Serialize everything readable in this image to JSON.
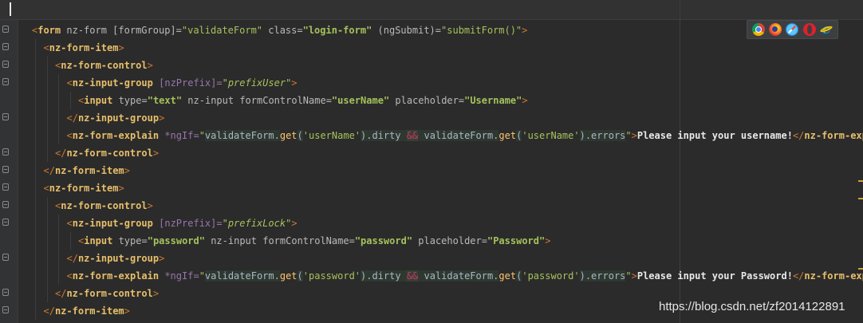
{
  "editor": {
    "lines": [
      [
        [
          "op",
          "<"
        ],
        [
          "tag",
          "form"
        ],
        [
          "attr",
          " nz-form "
        ],
        [
          "attr",
          "[formGroup]="
        ],
        [
          "str",
          "\"validateForm\""
        ],
        [
          "attr",
          " class="
        ],
        [
          "strb",
          "\"login-form\""
        ],
        [
          "attr",
          " (ngSubmit)="
        ],
        [
          "str",
          "\"submitForm()\""
        ],
        [
          "op",
          ">"
        ]
      ],
      [
        [
          "op",
          "<"
        ],
        [
          "tag",
          "nz-form-item"
        ],
        [
          "op",
          ">"
        ]
      ],
      [
        [
          "op",
          "<"
        ],
        [
          "tag",
          "nz-form-control"
        ],
        [
          "op",
          ">"
        ]
      ],
      [
        [
          "op",
          "<"
        ],
        [
          "tag",
          "nz-input-group"
        ],
        [
          "ngattr",
          " [nzPrefix]="
        ],
        [
          "stri",
          "\"prefixUser\""
        ],
        [
          "op",
          ">"
        ]
      ],
      [
        [
          "op",
          "<"
        ],
        [
          "tag",
          "input"
        ],
        [
          "attr",
          " type="
        ],
        [
          "strb",
          "\"text\""
        ],
        [
          "attr",
          " nz-input formControlName="
        ],
        [
          "strb",
          "\"userName\""
        ],
        [
          "attr",
          " placeholder="
        ],
        [
          "strb",
          "\"Username\""
        ],
        [
          "op",
          ">"
        ]
      ],
      [
        [
          "op",
          "</"
        ],
        [
          "tag",
          "nz-input-group"
        ],
        [
          "op",
          ">"
        ]
      ],
      [
        [
          "op",
          "<"
        ],
        [
          "tag",
          "nz-form-explain"
        ],
        [
          "ngattr",
          " *ngIf="
        ],
        [
          "str",
          "\""
        ],
        [
          "expr",
          "validateForm."
        ],
        [
          "fn",
          "get"
        ],
        [
          "expr",
          "("
        ],
        [
          "str",
          "'userName'"
        ],
        [
          "expr",
          ").dirty "
        ],
        [
          "amp",
          "&&"
        ],
        [
          "expr",
          " validateForm."
        ],
        [
          "fn",
          "get"
        ],
        [
          "expr",
          "("
        ],
        [
          "str",
          "'userName'"
        ],
        [
          "expr",
          ").errors"
        ],
        [
          "str",
          "\""
        ],
        [
          "op",
          ">"
        ],
        [
          "bold",
          "Please input your username!"
        ],
        [
          "op",
          "</"
        ],
        [
          "tag",
          "nz-form-explain"
        ],
        [
          "op",
          ">"
        ]
      ],
      [
        [
          "op",
          "</"
        ],
        [
          "tag",
          "nz-form-control"
        ],
        [
          "op",
          ">"
        ]
      ],
      [
        [
          "op",
          "</"
        ],
        [
          "tag",
          "nz-form-item"
        ],
        [
          "op",
          ">"
        ]
      ],
      [
        [
          "op",
          "<"
        ],
        [
          "tag",
          "nz-form-item"
        ],
        [
          "op",
          ">"
        ]
      ],
      [
        [
          "op",
          "<"
        ],
        [
          "tag",
          "nz-form-control"
        ],
        [
          "op",
          ">"
        ]
      ],
      [
        [
          "op",
          "<"
        ],
        [
          "tag",
          "nz-input-group"
        ],
        [
          "ngattr",
          " [nzPrefix]="
        ],
        [
          "stri",
          "\"prefixLock\""
        ],
        [
          "op",
          ">"
        ]
      ],
      [
        [
          "op",
          "<"
        ],
        [
          "tag",
          "input"
        ],
        [
          "attr",
          " type="
        ],
        [
          "strb",
          "\"password\""
        ],
        [
          "attr",
          " nz-input formControlName="
        ],
        [
          "strb",
          "\"password\""
        ],
        [
          "attr",
          " placeholder="
        ],
        [
          "strb",
          "\"Password\""
        ],
        [
          "op",
          ">"
        ]
      ],
      [
        [
          "op",
          "</"
        ],
        [
          "tag",
          "nz-input-group"
        ],
        [
          "op",
          ">"
        ]
      ],
      [
        [
          "op",
          "<"
        ],
        [
          "tag",
          "nz-form-explain"
        ],
        [
          "ngattr",
          " *ngIf="
        ],
        [
          "str",
          "\""
        ],
        [
          "expr",
          "validateForm."
        ],
        [
          "fn",
          "get"
        ],
        [
          "expr",
          "("
        ],
        [
          "str",
          "'password'"
        ],
        [
          "expr",
          ").dirty "
        ],
        [
          "amp",
          "&&"
        ],
        [
          "expr",
          " validateForm."
        ],
        [
          "fn",
          "get"
        ],
        [
          "expr",
          "("
        ],
        [
          "str",
          "'password'"
        ],
        [
          "expr",
          ").errors"
        ],
        [
          "str",
          "\""
        ],
        [
          "op",
          ">"
        ],
        [
          "bold",
          "Please input your Password!"
        ],
        [
          "op",
          "</"
        ],
        [
          "tag",
          "nz-form-explain"
        ],
        [
          "op",
          ">"
        ]
      ],
      [
        [
          "op",
          "</"
        ],
        [
          "tag",
          "nz-form-control"
        ],
        [
          "op",
          ">"
        ]
      ],
      [
        [
          "op",
          "</"
        ],
        [
          "tag",
          "nz-form-item"
        ],
        [
          "op",
          ">"
        ]
      ]
    ],
    "indents": [
      0,
      1,
      2,
      3,
      4,
      3,
      3,
      2,
      1,
      1,
      2,
      3,
      4,
      3,
      3,
      2,
      1
    ]
  },
  "browser_icons": [
    "chrome-icon",
    "firefox-icon",
    "safari-icon",
    "opera-icon",
    "ie-icon"
  ],
  "watermark": "https://blog.csdn.net/zf2014122891",
  "colors": {
    "background": "#2b2b2b",
    "tag": "#e8bf6a",
    "string": "#a5c25c",
    "attribute": "#bababa",
    "angular_attr": "#9876aa"
  }
}
